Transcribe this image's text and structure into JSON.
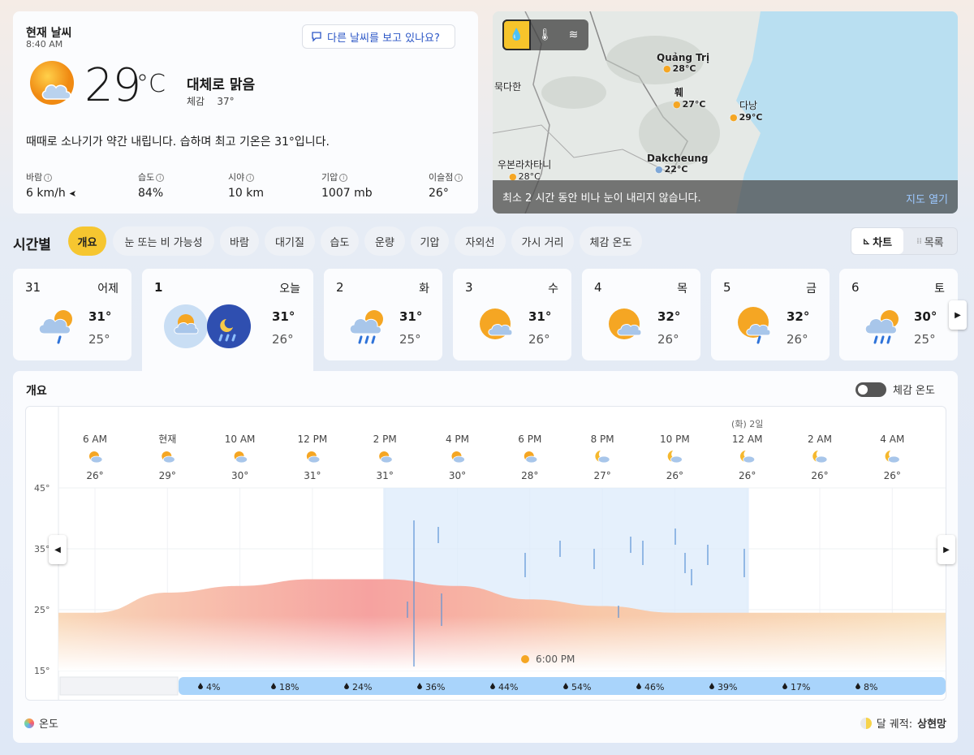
{
  "current": {
    "title": "현재 날씨",
    "time": "8:40 AM",
    "ask_button": "다른 날씨를 보고 있나요?",
    "temp": "29",
    "unit": "°C",
    "condition": "대체로 맑음",
    "feels_label": "체감",
    "feels_value": "37°",
    "summary": "때때로 소나기가 약간 내립니다. 습하며 최고 기온은 31°입니다.",
    "metrics": [
      {
        "label": "바람",
        "value": "6 km/h"
      },
      {
        "label": "습도",
        "value": "84%"
      },
      {
        "label": "시야",
        "value": "10 km"
      },
      {
        "label": "기압",
        "value": "1007 mb"
      },
      {
        "label": "이슬점",
        "value": "26°"
      }
    ]
  },
  "map": {
    "tools": [
      "precipitation-icon",
      "thermometer-icon",
      "wind-icon"
    ],
    "cities": [
      {
        "name": "Quảng Trị",
        "temp": "28°C"
      },
      {
        "name": "훼",
        "temp": "27°C"
      },
      {
        "name": "다낭",
        "temp": "29°C"
      },
      {
        "name": "Dakcheung",
        "temp": "22°C"
      },
      {
        "name": "우본라차타니",
        "temp": "28°C"
      },
      {
        "name": "묵다한",
        "temp": ""
      }
    ],
    "footer": "최소 2 시간 동안 비나 눈이 내리지 않습니다.",
    "open_label": "지도 열기"
  },
  "hourly": {
    "title": "시간별",
    "tabs": [
      "개요",
      "눈 또는 비 가능성",
      "바람",
      "대기질",
      "습도",
      "운량",
      "기압",
      "자외선",
      "가시 거리",
      "체감 온도"
    ],
    "view_chart": "차트",
    "view_list": "목록"
  },
  "days": [
    {
      "num": "31",
      "name": "어제",
      "hi": "31°",
      "lo": "25°"
    },
    {
      "num": "1",
      "name": "오늘",
      "hi": "31°",
      "lo": "26°"
    },
    {
      "num": "2",
      "name": "화",
      "hi": "31°",
      "lo": "25°"
    },
    {
      "num": "3",
      "name": "수",
      "hi": "31°",
      "lo": "26°"
    },
    {
      "num": "4",
      "name": "목",
      "hi": "32°",
      "lo": "26°"
    },
    {
      "num": "5",
      "name": "금",
      "hi": "32°",
      "lo": "26°"
    },
    {
      "num": "6",
      "name": "토",
      "hi": "30°",
      "lo": "25°"
    }
  ],
  "overview": {
    "title": "개요",
    "feels_toggle": "체감 온도",
    "date_marker": "(화) 2일",
    "sunset_label": "6:00 PM",
    "legend_temp": "온도",
    "moon_label": "달 궤적:",
    "moon_phase": "상현망"
  },
  "chart_data": {
    "type": "area",
    "x": [
      "6 AM",
      "현재",
      "10 AM",
      "12 PM",
      "2 PM",
      "4 PM",
      "6 PM",
      "8 PM",
      "10 PM",
      "12 AM",
      "2 AM",
      "4 AM"
    ],
    "temps": [
      26,
      29,
      30,
      31,
      31,
      30,
      28,
      27,
      26,
      26,
      26,
      26
    ],
    "temp_labels": [
      "26°",
      "29°",
      "30°",
      "31°",
      "31°",
      "30°",
      "28°",
      "27°",
      "26°",
      "26°",
      "26°",
      "26°"
    ],
    "precip_labels": [
      "4%",
      "18%",
      "24%",
      "36%",
      "44%",
      "54%",
      "46%",
      "39%",
      "17%",
      "8%"
    ],
    "precip": [
      4,
      18,
      24,
      36,
      44,
      54,
      46,
      39,
      17,
      8
    ],
    "y_ticks": [
      "45°",
      "35°",
      "25°",
      "15°"
    ],
    "ylim": [
      15,
      45
    ]
  }
}
